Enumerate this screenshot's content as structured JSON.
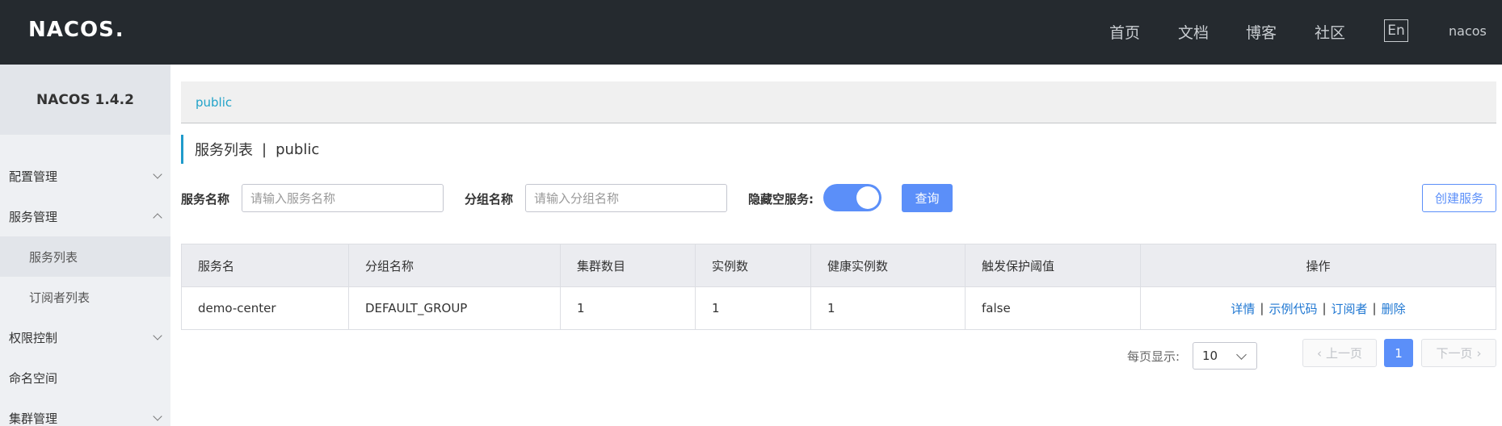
{
  "header": {
    "logo": "NACOS",
    "logo_dot": ".",
    "nav": [
      "首页",
      "文档",
      "博客",
      "社区"
    ],
    "lang": "En",
    "user": "nacos"
  },
  "sidebar": {
    "title": "NACOS 1.4.2",
    "items": [
      {
        "label": "配置管理",
        "chevron": "down"
      },
      {
        "label": "服务管理",
        "chevron": "up"
      },
      {
        "label": "服务列表",
        "sub": true,
        "active": true
      },
      {
        "label": "订阅者列表",
        "sub": true
      },
      {
        "label": "权限控制",
        "chevron": "down"
      },
      {
        "label": "命名空间"
      },
      {
        "label": "集群管理",
        "chevron": "down"
      }
    ]
  },
  "namespace_crumb": "public",
  "page": {
    "title": "服务列表",
    "separator": "|",
    "namespace": "public"
  },
  "filters": {
    "service_name_label": "服务名称",
    "service_name_placeholder": "请输入服务名称",
    "group_name_label": "分组名称",
    "group_name_placeholder": "请输入分组名称",
    "hide_empty_label": "隐藏空服务:",
    "hide_empty_on": true,
    "query_button": "查询",
    "create_button": "创建服务"
  },
  "table": {
    "columns": [
      "服务名",
      "分组名称",
      "集群数目",
      "实例数",
      "健康实例数",
      "触发保护阈值",
      "操作"
    ],
    "rows": [
      {
        "service": "demo-center",
        "group": "DEFAULT_GROUP",
        "clusters": "1",
        "instances": "1",
        "healthy": "1",
        "threshold": "false",
        "actions": [
          "详情",
          "示例代码",
          "订阅者",
          "删除"
        ]
      }
    ]
  },
  "pagination": {
    "page_size_label": "每页显示:",
    "page_size": "10",
    "prev": "上一页",
    "current": "1",
    "next": "下一页"
  },
  "colors": {
    "topbar": "#252a2f",
    "primary": "#5b8ff9",
    "link": "#1f77d2",
    "crumb": "#22a3c9"
  }
}
